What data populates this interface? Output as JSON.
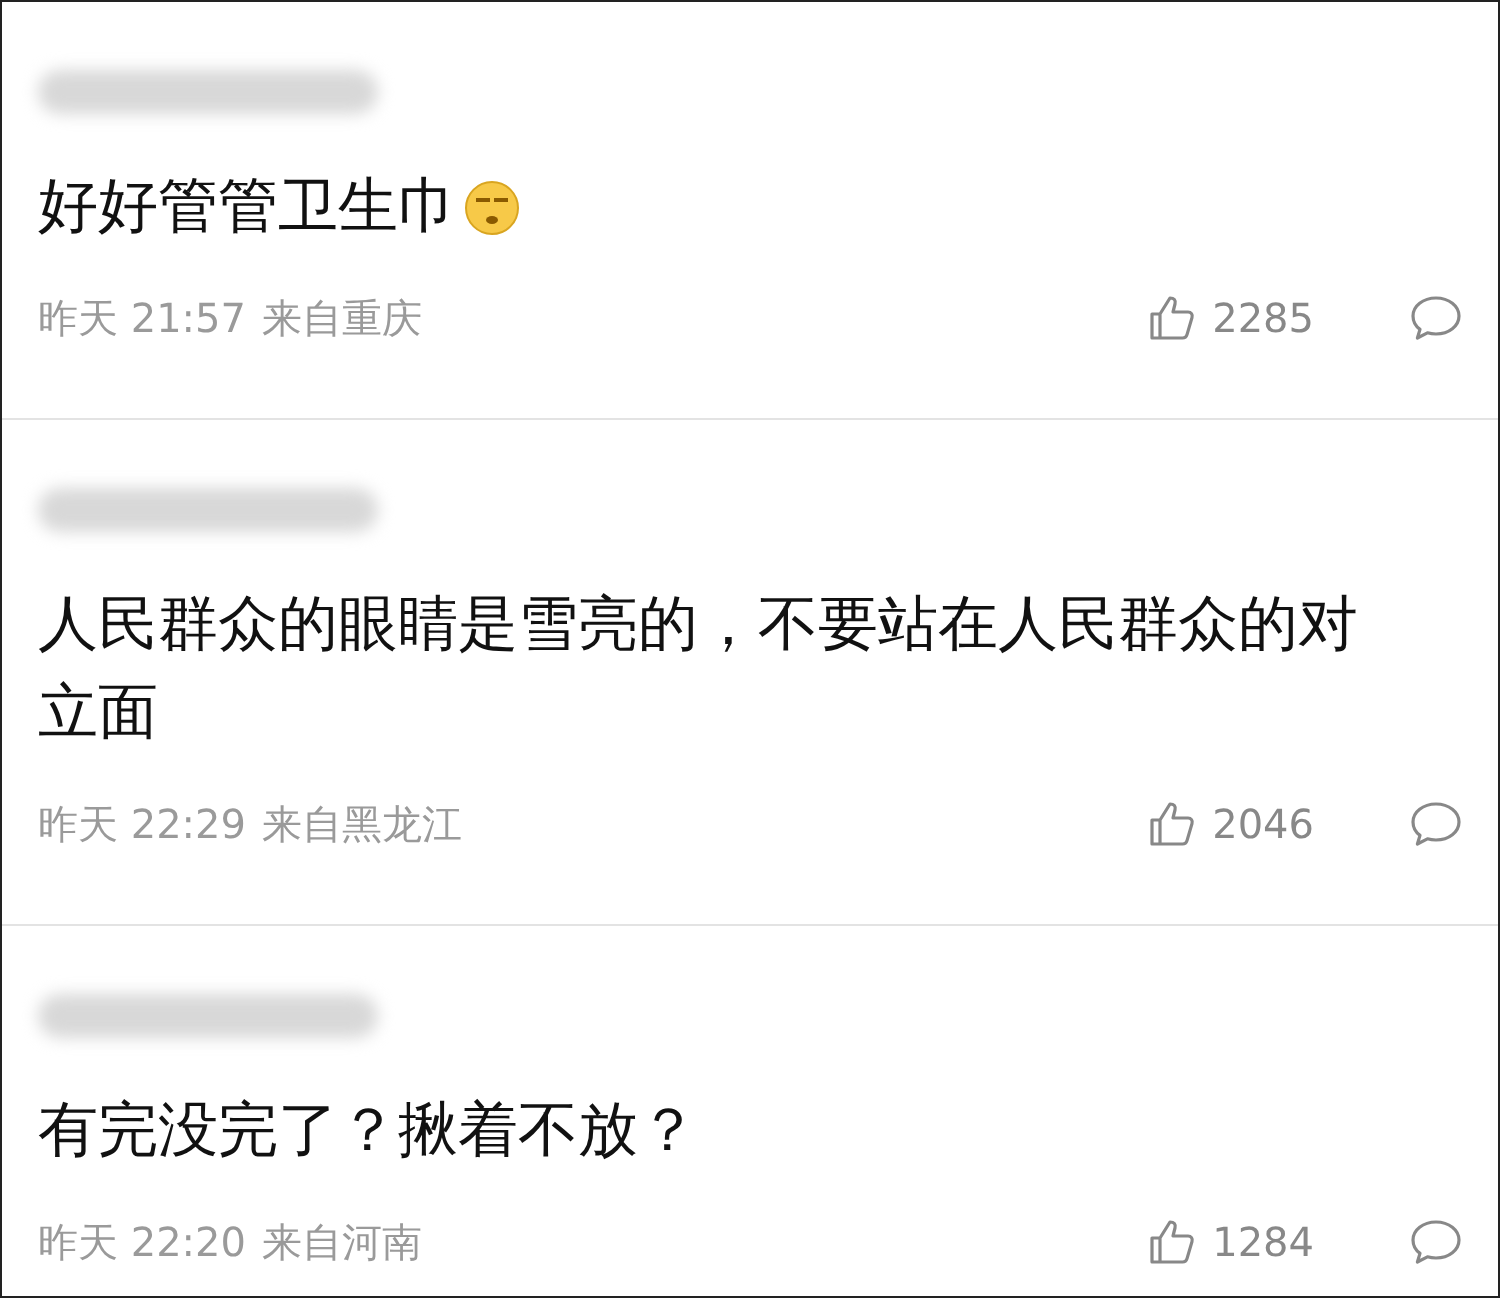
{
  "comments": [
    {
      "text": "好好管管卫生巾",
      "has_emoji": true,
      "time": "昨天 21:57",
      "location": "来自重庆",
      "likes": "2285"
    },
    {
      "text": "人民群众的眼睛是雪亮的，不要站在人民群众的对立面",
      "has_emoji": false,
      "time": "昨天 22:29",
      "location": "来自黑龙江",
      "likes": "2046"
    },
    {
      "text": "有完没完了？揪着不放？",
      "has_emoji": false,
      "time": "昨天 22:20",
      "location": "来自河南",
      "likes": "1284"
    }
  ]
}
